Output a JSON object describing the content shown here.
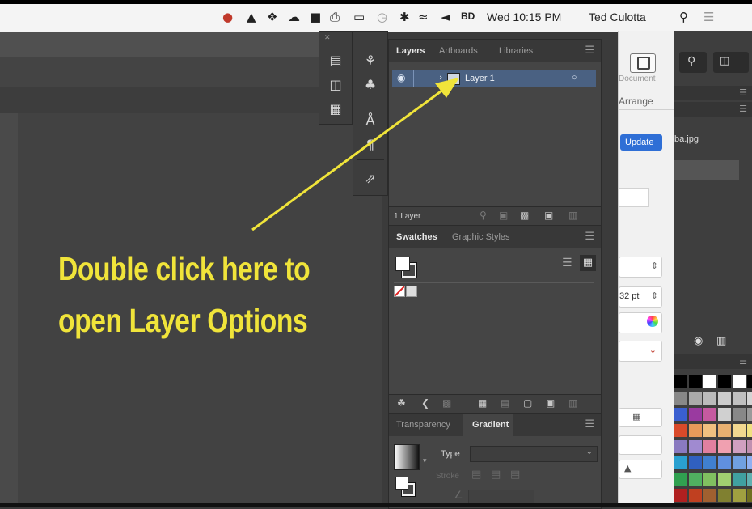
{
  "menubar": {
    "clock": "Wed 10:15 PM",
    "user": "Ted Culotta",
    "battery_label": "BD",
    "icons": [
      "adobe-cc-icon",
      "flame-icon",
      "dropbox-icon",
      "cloud-icon",
      "evernote-icon",
      "printer-icon",
      "airplay-icon",
      "timemachine-icon",
      "bluetooth-icon",
      "wifi-icon",
      "volume-icon",
      "spotlight-icon",
      "notification-icon"
    ]
  },
  "layers_panel": {
    "tabs": [
      "Layers",
      "Artboards",
      "Libraries"
    ],
    "active_tab": "Layers",
    "layer_row": {
      "name": "Layer 1"
    },
    "footer": "1 Layer"
  },
  "swatches_panel": {
    "tabs": [
      "Swatches",
      "Graphic Styles"
    ],
    "active_tab": "Swatches"
  },
  "gradient_panel": {
    "tabs": [
      "Transparency",
      "Gradient"
    ],
    "active_tab": "Gradient",
    "type_label": "Type",
    "stroke_label": "Stroke"
  },
  "document_panel": {
    "document_label": "Document",
    "arrange_label": "Arrange",
    "update_button": "Update",
    "file_name": "ba.jpg",
    "stroke_value": "32 pt"
  },
  "annotation": {
    "line1": "Double click here to",
    "line2": "open Layer Options",
    "color": "#f0e43a"
  },
  "colors": {
    "accent_blue": "#2f6fd6",
    "panel_bg": "#454545",
    "selected_row": "#4a6182"
  }
}
